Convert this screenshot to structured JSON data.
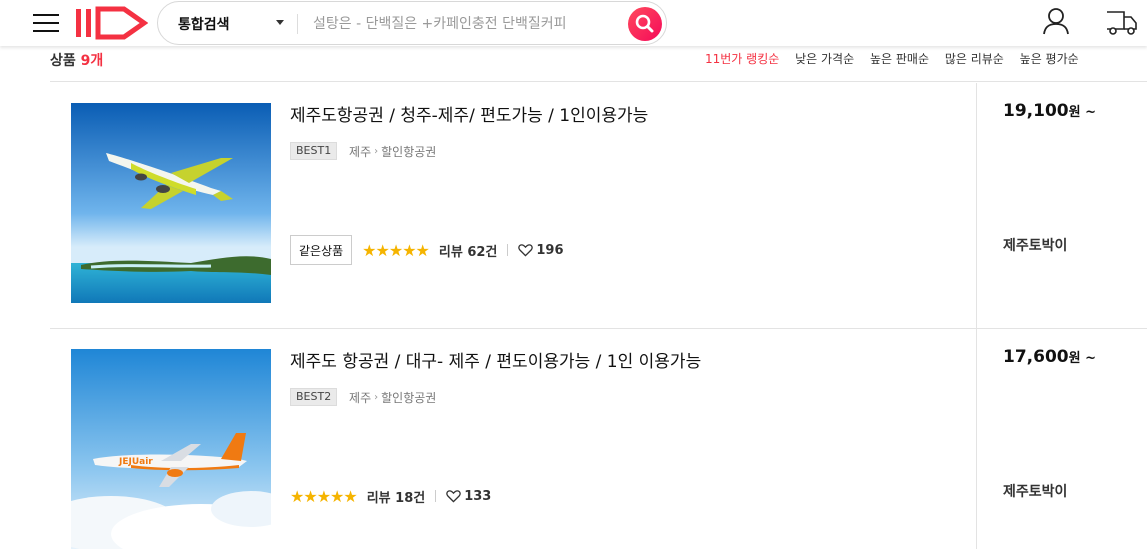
{
  "header": {
    "search_category": "통합검색",
    "search_placeholder": "설탕은 - 단백질은 +카페인충전 단백질커피"
  },
  "sort_bar": {
    "count_label": "상품",
    "count_value": "9개",
    "options": [
      "11번가 랭킹순",
      "낮은 가격순",
      "높은 판매순",
      "많은 리뷰순",
      "높은 평가순"
    ]
  },
  "products": [
    {
      "title": "제주도항공권 / 청주-제주/ 편도가능 / 1인이용가능",
      "badge": "BEST1",
      "category_path": [
        "제주",
        "할인항공권"
      ],
      "same_product_label": "같은상품",
      "rating_stars": "★★★★★",
      "rating": 5,
      "review_text": "리뷰 62건",
      "likes": "196",
      "price": "19,100",
      "price_unit": "원 ~",
      "seller": "제주토박이"
    },
    {
      "title": "제주도 항공권 / 대구- 제주 / 편도이용가능 / 1인 이용가능",
      "badge": "BEST2",
      "category_path": [
        "제주",
        "할인항공권"
      ],
      "rating_stars": "★★★★★",
      "rating": 5,
      "review_text": "리뷰 18건",
      "likes": "133",
      "price": "17,600",
      "price_unit": "원 ~",
      "seller": "제주토박이"
    }
  ],
  "colors": {
    "brand": "#f43142",
    "star": "#f5b400",
    "search_button": "#f50a5a"
  }
}
